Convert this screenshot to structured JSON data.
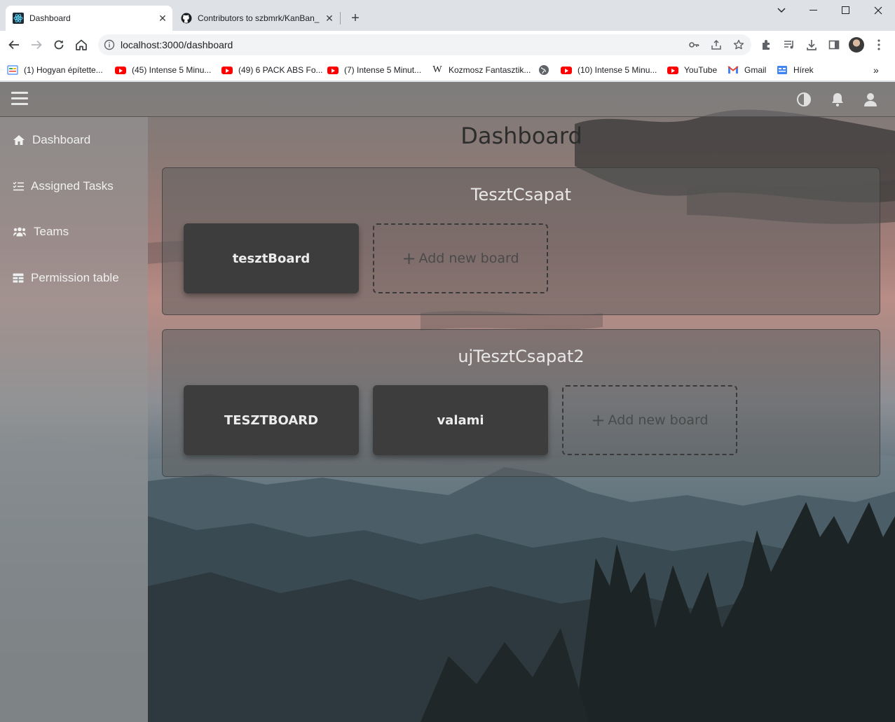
{
  "browser": {
    "tabs": [
      {
        "title": "Dashboard",
        "active": true
      },
      {
        "title": "Contributors to szbmrk/KanBan_",
        "active": false
      }
    ],
    "url": "localhost:3000/dashboard",
    "bookmarks": [
      {
        "label": "(1) Hogyan építette...",
        "icon": "news-icon"
      },
      {
        "label": "(45) Intense 5 Minu...",
        "icon": "youtube-icon"
      },
      {
        "label": "(49) 6 PACK ABS Fo...",
        "icon": "youtube-icon"
      },
      {
        "label": "(7) Intense 5 Minut...",
        "icon": "youtube-icon"
      },
      {
        "label": "Kozmosz Fantasztik...",
        "icon": "wikipedia-icon"
      },
      {
        "label": "",
        "icon": "globe-icon"
      },
      {
        "label": "(10) Intense 5 Minu...",
        "icon": "youtube-icon"
      },
      {
        "label": "YouTube",
        "icon": "youtube-icon"
      },
      {
        "label": "Gmail",
        "icon": "gmail-icon"
      },
      {
        "label": "Hírek",
        "icon": "news-icon"
      }
    ]
  },
  "app": {
    "sidebar": [
      {
        "label": "Dashboard",
        "icon": "home-icon"
      },
      {
        "label": "Assigned Tasks",
        "icon": "task-list-icon"
      },
      {
        "label": "Teams",
        "icon": "team-icon"
      },
      {
        "label": "Permission table",
        "icon": "table-icon"
      }
    ],
    "title": "Dashboard",
    "add_board_label": "Add new board",
    "teams": [
      {
        "name": "TesztCsapat",
        "boards": [
          "tesztBoard"
        ]
      },
      {
        "name": "ujTesztCsapat2",
        "boards": [
          "TESZTBOARD",
          "valami"
        ]
      }
    ]
  }
}
